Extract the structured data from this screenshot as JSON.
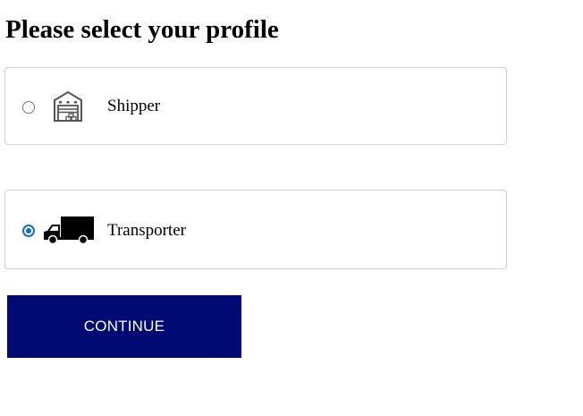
{
  "page": {
    "title": "Please select your profile"
  },
  "profiles": [
    {
      "label": "Shipper",
      "selected": false,
      "icon": "warehouse-icon"
    },
    {
      "label": "Transporter",
      "selected": true,
      "icon": "truck-icon"
    }
  ],
  "actions": {
    "continue_label": "CONTINUE"
  },
  "colors": {
    "button_background": "#000a73",
    "button_text": "#ffffff",
    "radio_selected": "#0a6fd6",
    "card_border": "#cfcfcf"
  }
}
